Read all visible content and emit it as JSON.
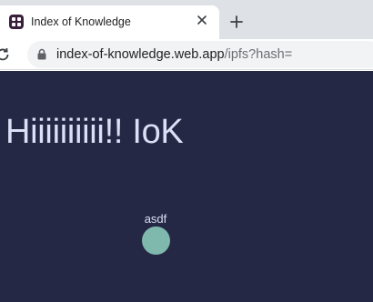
{
  "tab": {
    "title": "Index of Knowledge",
    "favicon": "app-grid-icon",
    "close_icon": "close-icon"
  },
  "new_tab_icon": "plus-icon",
  "toolbar": {
    "reload_icon": "reload-icon",
    "lock_icon": "lock-icon",
    "url_host": "index-of-knowledge.web.app",
    "url_path": "/ipfs?hash="
  },
  "page": {
    "background": "#252844",
    "headline": "Hiiiiiiiiii!! IoK",
    "node": {
      "label": "asdf",
      "color": "#7fb8ad"
    }
  }
}
